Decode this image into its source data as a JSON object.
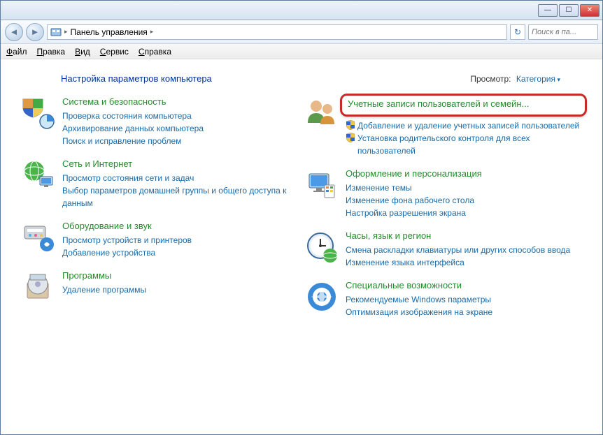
{
  "titlebar": {
    "min": "—",
    "max": "☐",
    "close": "✕"
  },
  "breadcrumb": {
    "root": "Панель управления",
    "sep": "▸"
  },
  "search": {
    "placeholder": "Поиск в па..."
  },
  "refresh_glyph": "↻",
  "nav": {
    "back": "◄",
    "fwd": "►"
  },
  "menu": {
    "file": "Файл",
    "file_u": "Ф",
    "edit": "Правка",
    "edit_u": "П",
    "view": "Вид",
    "view_u": "В",
    "tools": "Сервис",
    "tools_u": "С",
    "help": "Справка",
    "help_u": "С"
  },
  "heading": "Настройка параметров компьютера",
  "view_label": "Просмотр:",
  "view_value": "Категория",
  "categories": {
    "system": {
      "title": "Система и безопасность",
      "links": [
        "Проверка состояния компьютера",
        "Архивирование данных компьютера",
        "Поиск и исправление проблем"
      ]
    },
    "network": {
      "title": "Сеть и Интернет",
      "links": [
        "Просмотр состояния сети и задач",
        "Выбор параметров домашней группы и общего доступа к данным"
      ]
    },
    "hardware": {
      "title": "Оборудование и звук",
      "links": [
        "Просмотр устройств и принтеров",
        "Добавление устройства"
      ]
    },
    "programs": {
      "title": "Программы",
      "links": [
        "Удаление программы"
      ]
    },
    "users": {
      "title": "Учетные записи пользователей и семейн...",
      "links": [
        "Добавление и удаление учетных записей пользователей",
        "Установка родительского контроля для всех пользователей"
      ]
    },
    "appearance": {
      "title": "Оформление и персонализация",
      "links": [
        "Изменение темы",
        "Изменение фона рабочего стола",
        "Настройка разрешения экрана"
      ]
    },
    "clock": {
      "title": "Часы, язык и регион",
      "links": [
        "Смена раскладки клавиатуры или других способов ввода",
        "Изменение языка интерфейса"
      ]
    },
    "access": {
      "title": "Специальные возможности",
      "links": [
        "Рекомендуемые Windows параметры",
        "Оптимизация изображения на экране"
      ]
    }
  }
}
